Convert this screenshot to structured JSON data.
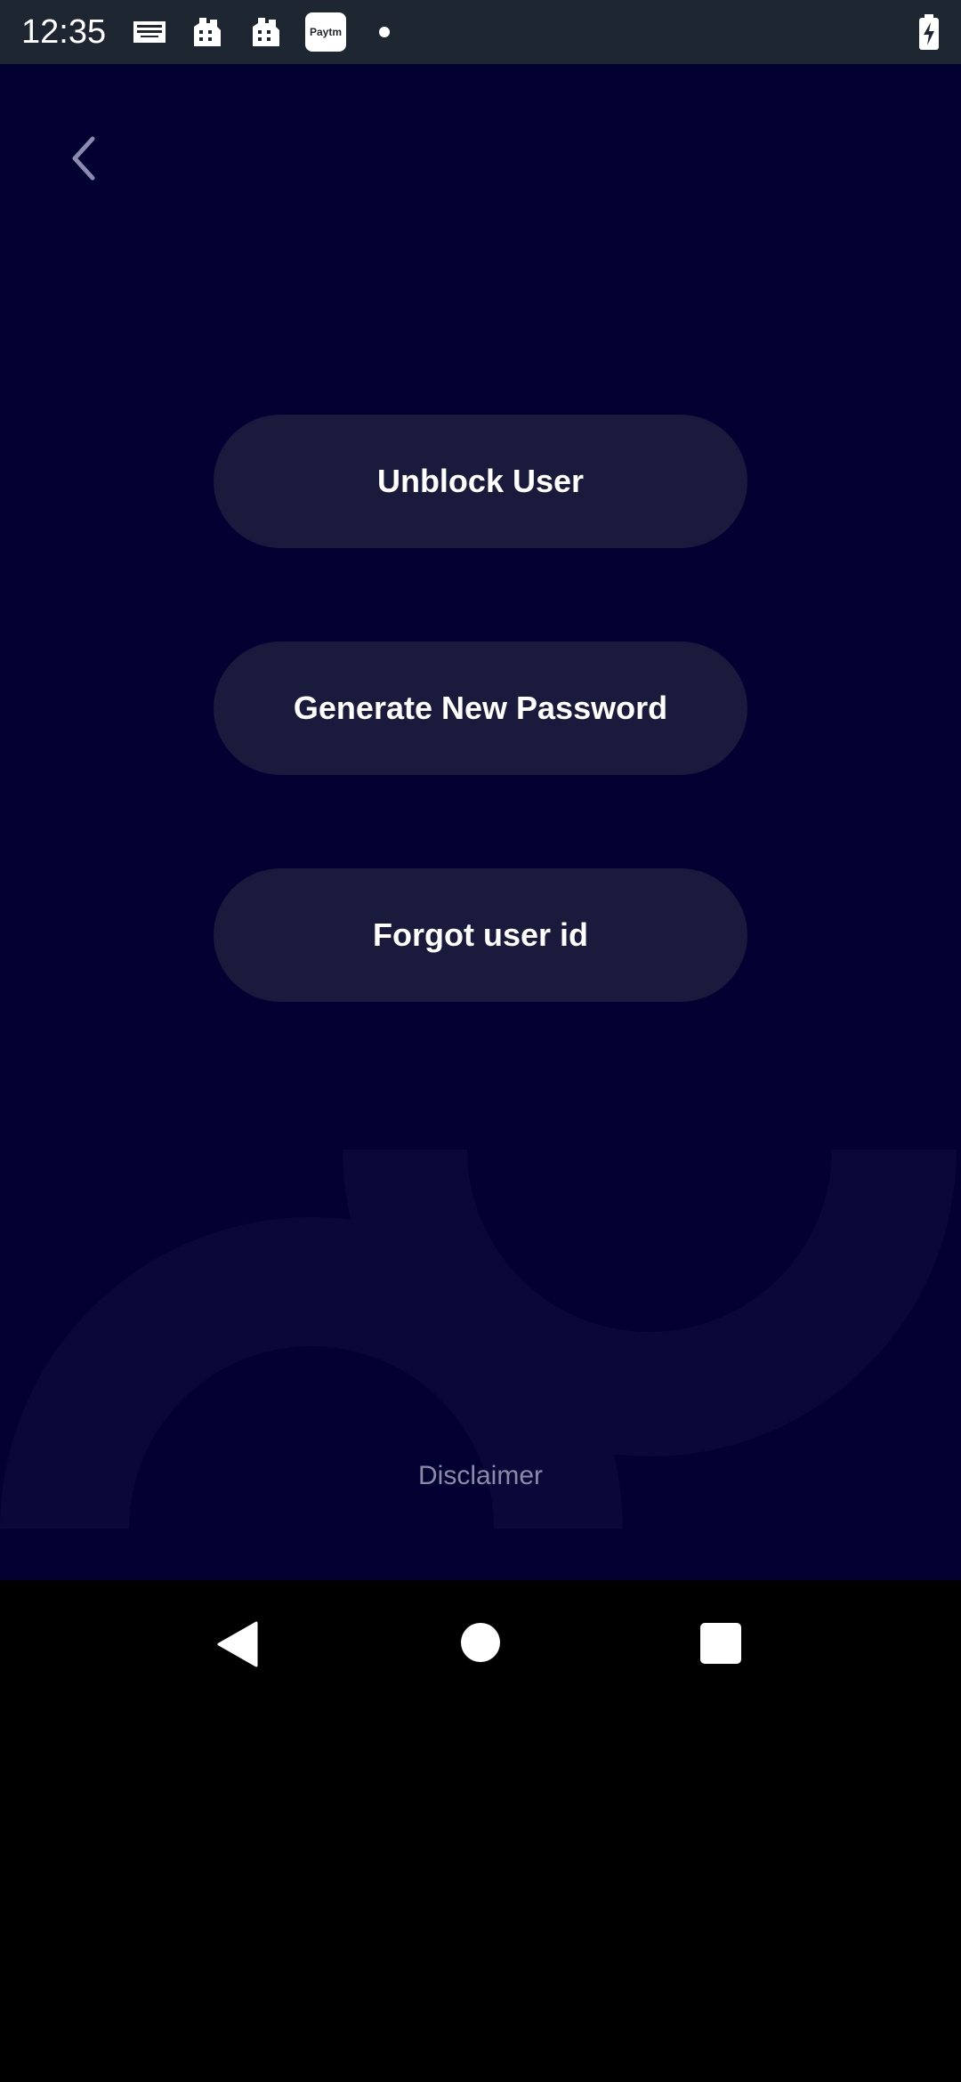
{
  "status_bar": {
    "time": "12:35",
    "icons": [
      "farm-bureau-icon",
      "building-icon",
      "building-icon",
      "paytm-icon",
      "dot-icon",
      "battery-charging-icon"
    ],
    "paytm_label": "Paytm"
  },
  "header": {
    "back_icon": "chevron-left-icon"
  },
  "menu": {
    "unblock_label": "Unblock User",
    "generate_label": "Generate New Password",
    "forgot_label": "Forgot user id"
  },
  "footer": {
    "disclaimer_label": "Disclaimer"
  },
  "navigation": {
    "icons": [
      "triangle-back-icon",
      "circle-home-icon",
      "square-recents-icon"
    ]
  },
  "colors": {
    "background": "#030131",
    "button": "#1a1a3d",
    "status_bar": "#1e2631",
    "disclaimer_text": "#8b8ba7"
  }
}
